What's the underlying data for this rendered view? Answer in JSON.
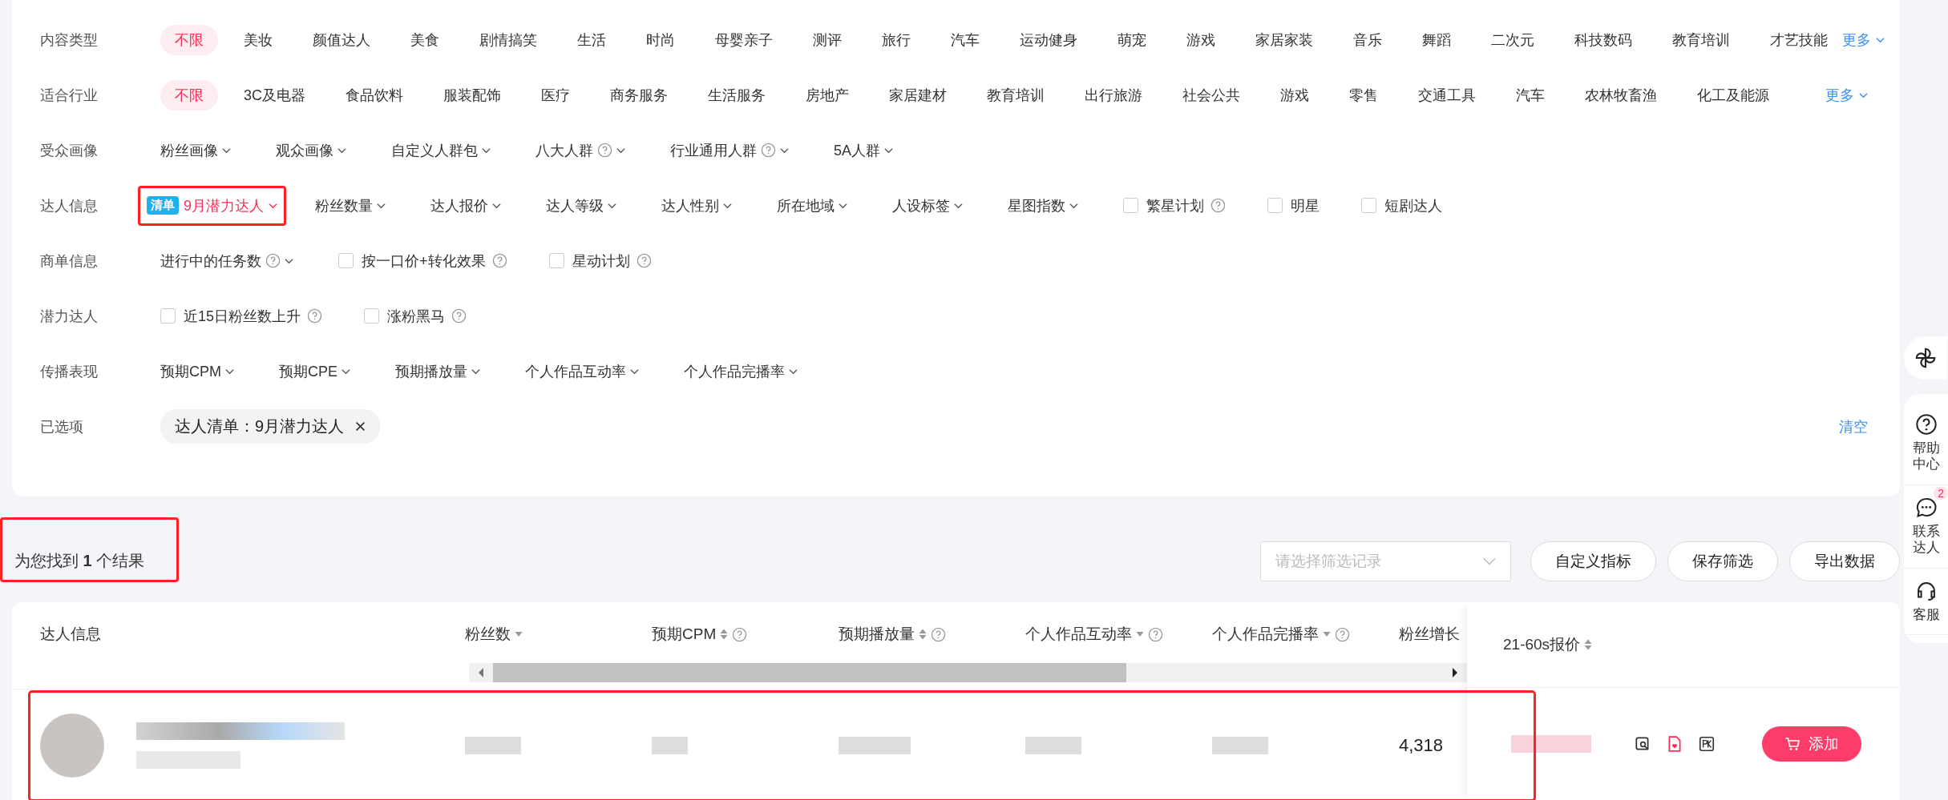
{
  "filters": [
    {
      "label": "内容类型",
      "more": "更多",
      "items": [
        {
          "kind": "tag",
          "text": "不限",
          "selected": true
        },
        {
          "kind": "tag",
          "text": "美妆",
          "selected": false
        },
        {
          "kind": "tag",
          "text": "颜值达人",
          "selected": false
        },
        {
          "kind": "tag",
          "text": "美食",
          "selected": false
        },
        {
          "kind": "tag",
          "text": "剧情搞笑",
          "selected": false
        },
        {
          "kind": "tag",
          "text": "生活",
          "selected": false
        },
        {
          "kind": "tag",
          "text": "时尚",
          "selected": false
        },
        {
          "kind": "tag",
          "text": "母婴亲子",
          "selected": false
        },
        {
          "kind": "tag",
          "text": "测评",
          "selected": false
        },
        {
          "kind": "tag",
          "text": "旅行",
          "selected": false
        },
        {
          "kind": "tag",
          "text": "汽车",
          "selected": false
        },
        {
          "kind": "tag",
          "text": "运动健身",
          "selected": false
        },
        {
          "kind": "tag",
          "text": "萌宠",
          "selected": false
        },
        {
          "kind": "tag",
          "text": "游戏",
          "selected": false
        },
        {
          "kind": "tag",
          "text": "家居家装",
          "selected": false
        },
        {
          "kind": "tag",
          "text": "音乐",
          "selected": false
        },
        {
          "kind": "tag",
          "text": "舞蹈",
          "selected": false
        },
        {
          "kind": "tag",
          "text": "二次元",
          "selected": false
        },
        {
          "kind": "tag",
          "text": "科技数码",
          "selected": false
        },
        {
          "kind": "tag",
          "text": "教育培训",
          "selected": false
        },
        {
          "kind": "tag",
          "text": "才艺技能",
          "selected": false
        }
      ]
    },
    {
      "label": "适合行业",
      "more": "更多",
      "items": [
        {
          "kind": "tag",
          "text": "不限",
          "selected": true
        },
        {
          "kind": "tag",
          "text": "3C及电器",
          "selected": false
        },
        {
          "kind": "tag",
          "text": "食品饮料",
          "selected": false
        },
        {
          "kind": "tag",
          "text": "服装配饰",
          "selected": false
        },
        {
          "kind": "tag",
          "text": "医疗",
          "selected": false
        },
        {
          "kind": "tag",
          "text": "商务服务",
          "selected": false
        },
        {
          "kind": "tag",
          "text": "生活服务",
          "selected": false
        },
        {
          "kind": "tag",
          "text": "房地产",
          "selected": false
        },
        {
          "kind": "tag",
          "text": "家居建材",
          "selected": false
        },
        {
          "kind": "tag",
          "text": "教育培训",
          "selected": false
        },
        {
          "kind": "tag",
          "text": "出行旅游",
          "selected": false
        },
        {
          "kind": "tag",
          "text": "社会公共",
          "selected": false
        },
        {
          "kind": "tag",
          "text": "游戏",
          "selected": false
        },
        {
          "kind": "tag",
          "text": "零售",
          "selected": false
        },
        {
          "kind": "tag",
          "text": "交通工具",
          "selected": false
        },
        {
          "kind": "tag",
          "text": "汽车",
          "selected": false
        },
        {
          "kind": "tag",
          "text": "农林牧畜渔",
          "selected": false
        },
        {
          "kind": "tag",
          "text": "化工及能源",
          "selected": false
        }
      ]
    },
    {
      "label": "受众画像",
      "items": [
        {
          "kind": "dropdown",
          "text": "粉丝画像",
          "help": false
        },
        {
          "kind": "dropdown",
          "text": "观众画像",
          "help": false
        },
        {
          "kind": "dropdown",
          "text": "自定义人群包",
          "help": false
        },
        {
          "kind": "dropdown",
          "text": "八大人群",
          "help": true
        },
        {
          "kind": "dropdown",
          "text": "行业通用人群",
          "help": true
        },
        {
          "kind": "dropdown",
          "text": "5A人群",
          "help": false
        }
      ]
    },
    {
      "label": "达人信息",
      "items": [
        {
          "kind": "list",
          "badge": "清单",
          "text": "9月潜力达人",
          "highlighted": true
        },
        {
          "kind": "dropdown",
          "text": "粉丝数量",
          "help": false
        },
        {
          "kind": "dropdown",
          "text": "达人报价",
          "help": false
        },
        {
          "kind": "dropdown",
          "text": "达人等级",
          "help": false
        },
        {
          "kind": "dropdown",
          "text": "达人性别",
          "help": false
        },
        {
          "kind": "dropdown",
          "text": "所在地域",
          "help": false
        },
        {
          "kind": "dropdown",
          "text": "人设标签",
          "help": false
        },
        {
          "kind": "dropdown",
          "text": "星图指数",
          "help": false
        },
        {
          "kind": "checkbox",
          "text": "繁星计划",
          "checked": false,
          "help": true
        },
        {
          "kind": "checkbox",
          "text": "明星",
          "checked": false,
          "help": false
        },
        {
          "kind": "checkbox",
          "text": "短剧达人",
          "checked": false,
          "help": false
        }
      ]
    },
    {
      "label": "商单信息",
      "items": [
        {
          "kind": "dropdown",
          "text": "进行中的任务数",
          "help": true
        },
        {
          "kind": "checkbox",
          "text": "按一口价+转化效果",
          "checked": false,
          "help": true
        },
        {
          "kind": "checkbox",
          "text": "星动计划",
          "checked": false,
          "help": true
        }
      ]
    },
    {
      "label": "潜力达人",
      "items": [
        {
          "kind": "checkbox",
          "text": "近15日粉丝数上升",
          "checked": false,
          "help": true
        },
        {
          "kind": "checkbox",
          "text": "涨粉黑马",
          "checked": false,
          "help": true
        }
      ]
    },
    {
      "label": "传播表现",
      "items": [
        {
          "kind": "dropdown",
          "text": "预期CPM",
          "help": false
        },
        {
          "kind": "dropdown",
          "text": "预期CPE",
          "help": false
        },
        {
          "kind": "dropdown",
          "text": "预期播放量",
          "help": false
        },
        {
          "kind": "dropdown",
          "text": "个人作品互动率",
          "help": false
        },
        {
          "kind": "dropdown",
          "text": "个人作品完播率",
          "help": false
        }
      ]
    },
    {
      "label": "已选项",
      "clear": "清空",
      "items": [
        {
          "kind": "chip",
          "text": "达人清单：9月潜力达人"
        }
      ]
    }
  ],
  "results": {
    "text": "为您找到 **1** 个结果",
    "highlighted": true
  },
  "toolbar": {
    "select_placeholder": "请选择筛选记录",
    "buttons": [
      "自定义指标",
      "保存筛选",
      "导出数据"
    ]
  },
  "table": {
    "columns": [
      {
        "label": "达人信息",
        "sort_up": false,
        "sort_down": false,
        "help": false
      },
      {
        "label": "粉丝数",
        "sort_up": false,
        "sort_down": true,
        "help": false
      },
      {
        "label": "预期CPM",
        "sort_up": true,
        "sort_down": true,
        "help": true
      },
      {
        "label": "预期播放量",
        "sort_up": true,
        "sort_down": true,
        "help": true
      },
      {
        "label": "个人作品互动率",
        "sort_up": false,
        "sort_down": true,
        "help": true
      },
      {
        "label": "个人作品完播率",
        "sort_up": false,
        "sort_down": true,
        "help": true
      },
      {
        "label": "粉丝增长",
        "sort_up": false,
        "sort_down": false,
        "help": false
      }
    ],
    "fixed_column": {
      "label": "21-60s报价",
      "sort_up": true,
      "sort_down": true
    },
    "rows": [
      {
        "fans_growth": "4,318",
        "action": "添加",
        "highlighted": true
      }
    ]
  },
  "sidebar": {
    "items": [
      {
        "kind": "help",
        "label": "帮助中心"
      },
      {
        "kind": "chat",
        "label": "联系达人",
        "badge": "2"
      },
      {
        "kind": "service",
        "label": "客服"
      }
    ]
  }
}
